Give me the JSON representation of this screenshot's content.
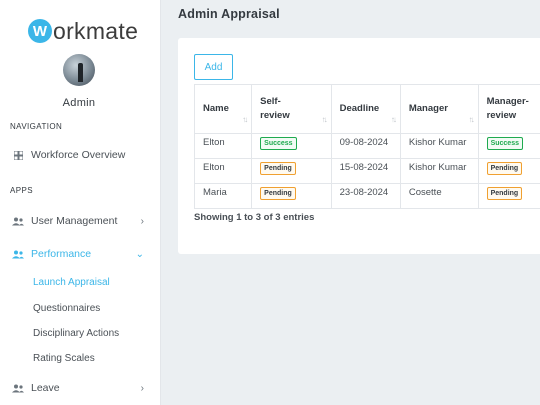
{
  "brand": {
    "mark": "W",
    "text": "orkmate",
    "color": "#3bb6e8"
  },
  "user": {
    "name": "Admin"
  },
  "sidebar": {
    "nav_title": "NAVIGATION",
    "apps_title": "APPS",
    "overview": {
      "label": "Workforce Overview",
      "icon": "grid-icon"
    },
    "user_management": {
      "label": "User Management",
      "icon": "users-icon"
    },
    "performance": {
      "label": "Performance",
      "icon": "users-icon",
      "expanded": true,
      "items": [
        {
          "label": "Launch Appraisal",
          "active": true
        },
        {
          "label": "Questionnaires"
        },
        {
          "label": "Disciplinary Actions"
        },
        {
          "label": "Rating Scales"
        }
      ]
    },
    "leave": {
      "label": "Leave",
      "icon": "users-icon"
    }
  },
  "main": {
    "title": "Admin Appraisal",
    "add_label": "Add",
    "table": {
      "headers": [
        [
          "Name"
        ],
        [
          "Self-",
          "review"
        ],
        [
          "Deadline"
        ],
        [
          "Manager"
        ],
        [
          "Manager-",
          "review"
        ]
      ],
      "rows": [
        {
          "name": "Elton",
          "self_review": "Success",
          "deadline": "09-08-2024",
          "manager": "Kishor Kumar",
          "manager_review": "Success"
        },
        {
          "name": "Elton",
          "self_review": "Pending",
          "deadline": "15-08-2024",
          "manager": "Kishor Kumar",
          "manager_review": "Pending"
        },
        {
          "name": "Maria",
          "self_review": "Pending",
          "deadline": "23-08-2024",
          "manager": "Cosette",
          "manager_review": "Pending"
        }
      ]
    },
    "info": "Showing 1 to 3 of 3 entries"
  },
  "colors": {
    "accent": "#3bb6e8",
    "success": "#1faa4f",
    "pending": "#f0a030"
  }
}
